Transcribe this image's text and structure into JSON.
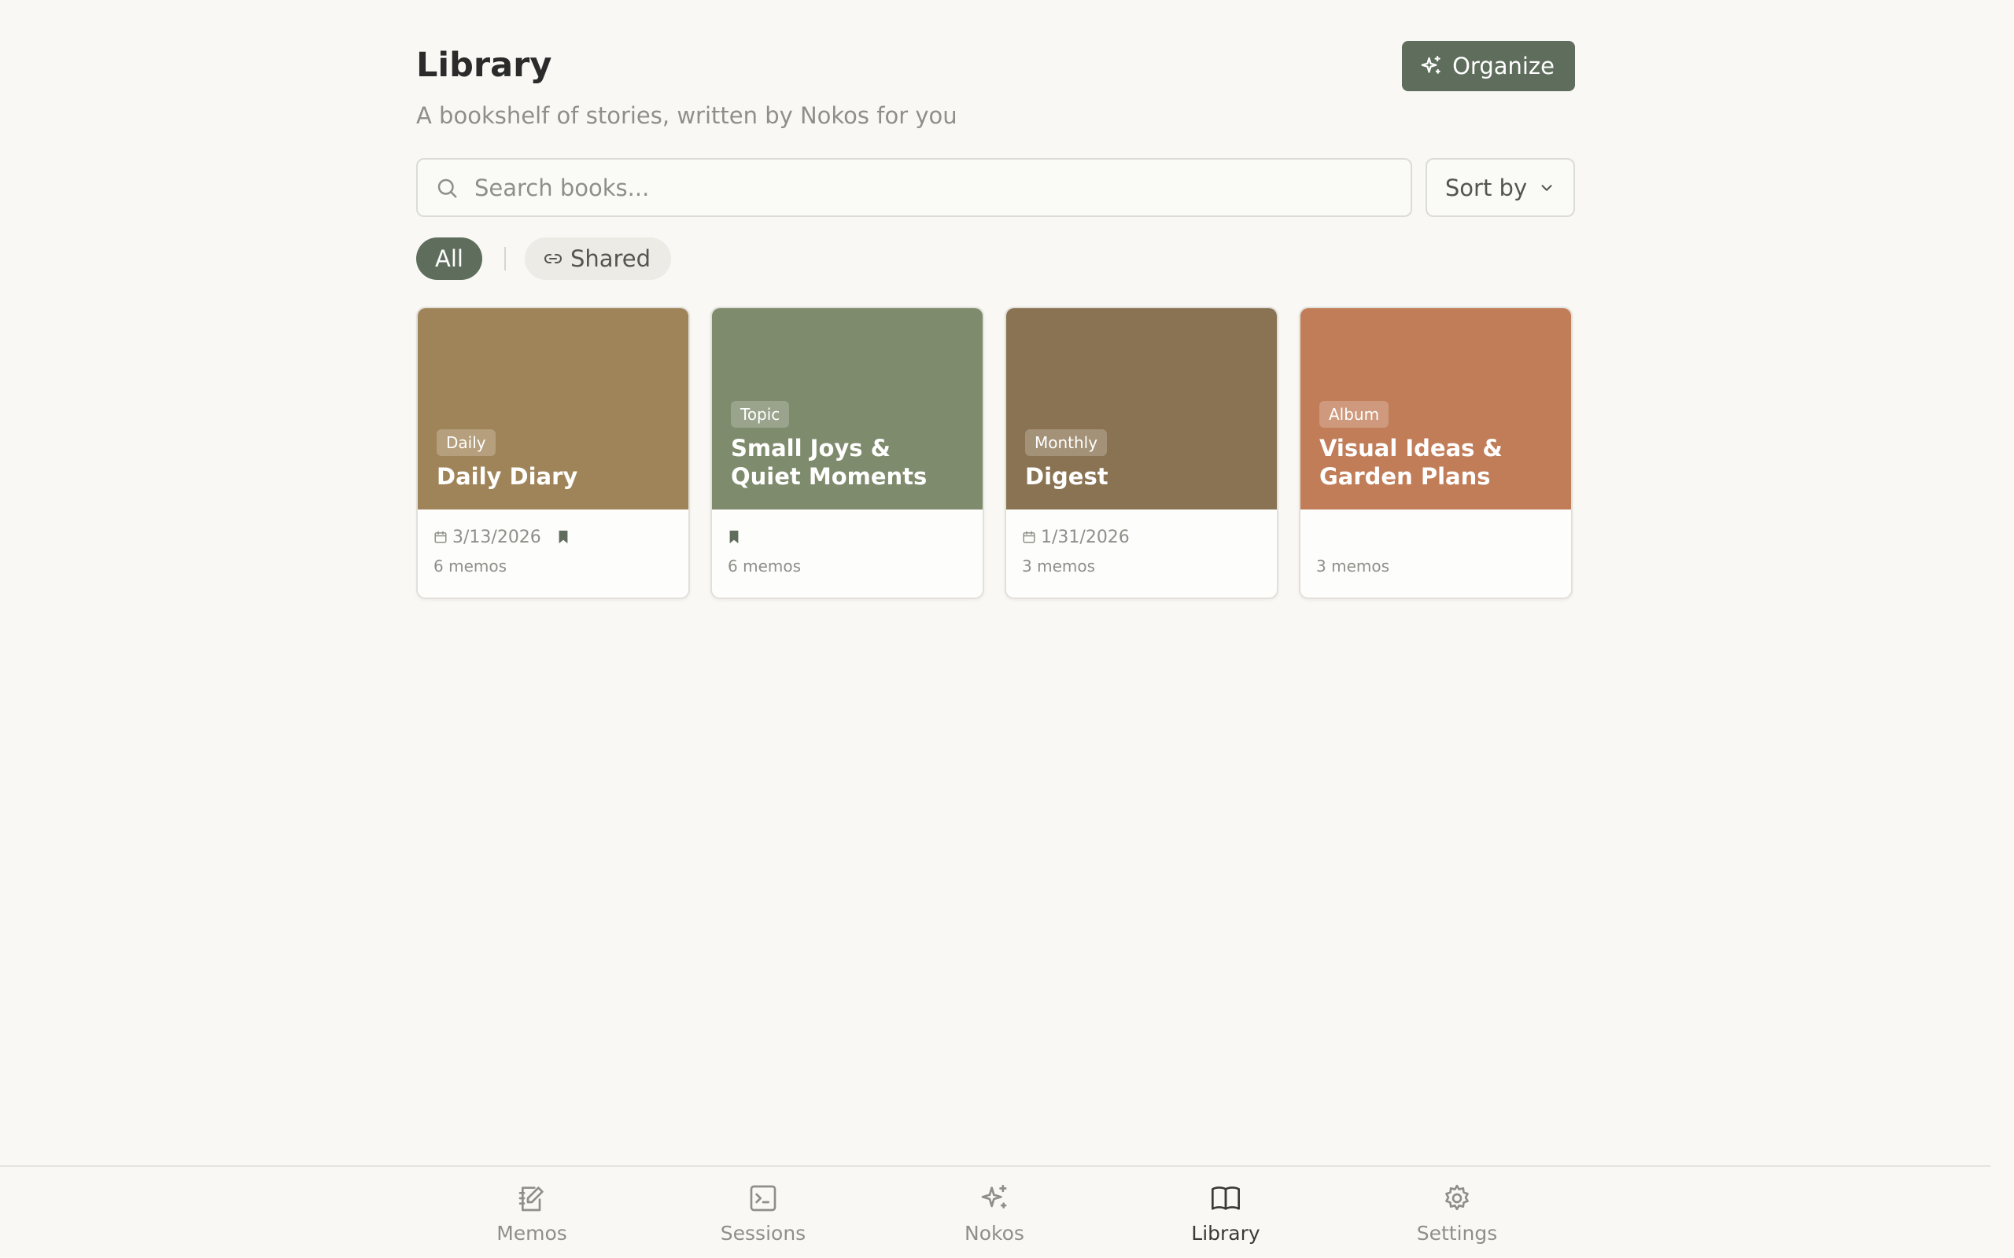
{
  "header": {
    "title": "Library",
    "subtitle": "A bookshelf of stories, written by Nokos for you",
    "organize_label": "Organize"
  },
  "search": {
    "placeholder": "Search books...",
    "value": "",
    "sort_label": "Sort by"
  },
  "filters": {
    "all_label": "All",
    "shared_label": "Shared",
    "active": "All"
  },
  "books": [
    {
      "badge": "Daily",
      "title": "Daily Diary",
      "date": "3/13/2026",
      "bookmarked": true,
      "memos": "6 memos",
      "color": "#a08459"
    },
    {
      "badge": "Topic",
      "title": "Small Joys & Quiet Moments",
      "date": "",
      "bookmarked": true,
      "memos": "6 memos",
      "color": "#7e8b6c"
    },
    {
      "badge": "Monthly",
      "title": "Digest",
      "date": "1/31/2026",
      "bookmarked": false,
      "memos": "3 memos",
      "color": "#8a7353"
    },
    {
      "badge": "Album",
      "title": "Visual Ideas & Garden Plans",
      "date": "",
      "bookmarked": false,
      "memos": "3 memos",
      "color": "#c07d58"
    }
  ],
  "nav": {
    "items": [
      {
        "label": "Memos",
        "icon": "memo-edit-icon"
      },
      {
        "label": "Sessions",
        "icon": "terminal-icon"
      },
      {
        "label": "Nokos",
        "icon": "sparkles-icon"
      },
      {
        "label": "Library",
        "icon": "open-book-icon"
      },
      {
        "label": "Settings",
        "icon": "gear-icon"
      }
    ],
    "active": "Library"
  },
  "colors": {
    "accent": "#5e6d5c",
    "background": "#f9f8f5",
    "muted_text": "#8f8f8a"
  }
}
